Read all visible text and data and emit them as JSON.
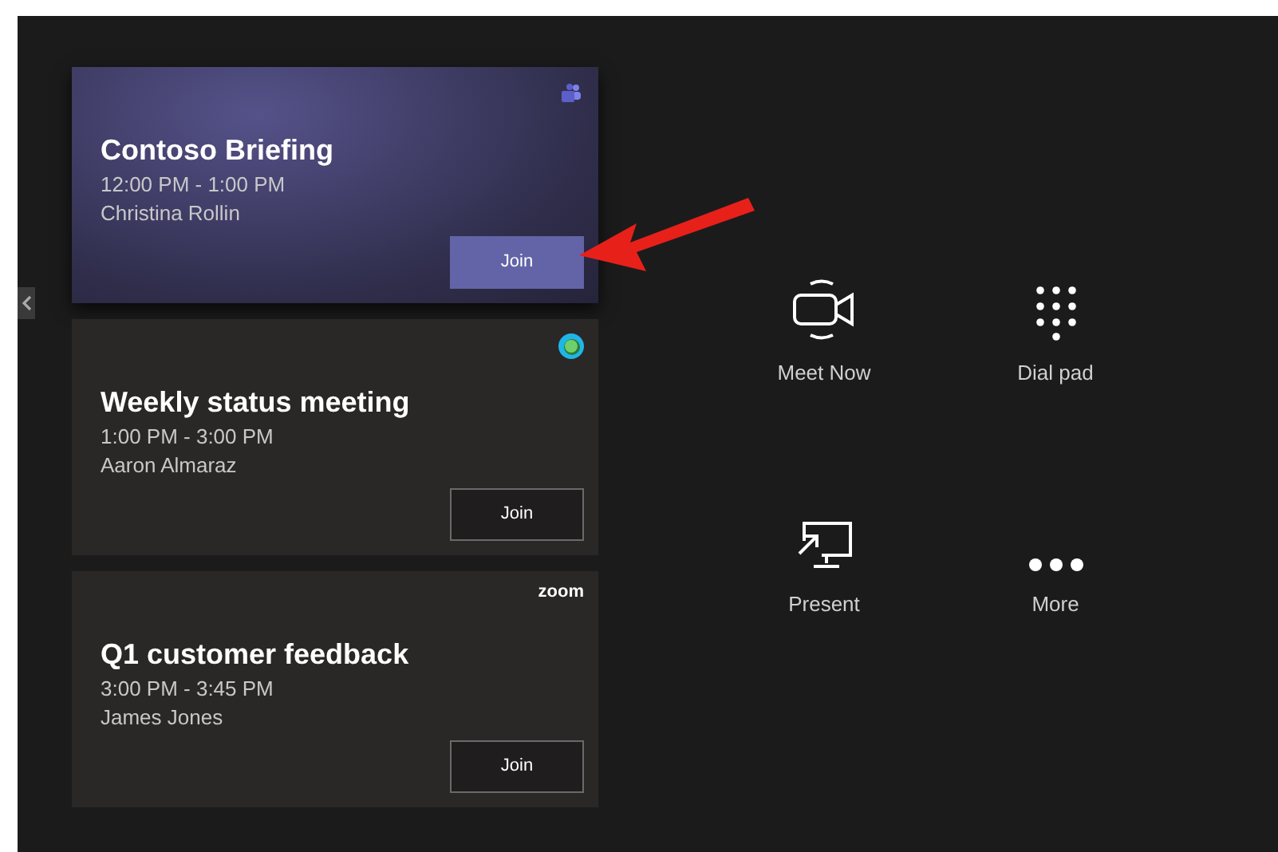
{
  "meetings": [
    {
      "title": "Contoso Briefing",
      "time": "12:00 PM - 1:00 PM",
      "organizer": "Christina Rollin",
      "join": "Join",
      "selected": true,
      "service": {
        "kind": "teams"
      }
    },
    {
      "title": "Weekly status meeting",
      "time": "1:00 PM - 3:00 PM",
      "organizer": "Aaron Almaraz",
      "join": "Join",
      "selected": false,
      "service": {
        "kind": "webex"
      }
    },
    {
      "title": "Q1 customer feedback",
      "time": "3:00 PM - 3:45 PM",
      "organizer": "James Jones",
      "join": "Join",
      "selected": false,
      "service": {
        "kind": "zoom",
        "text": "zoom"
      }
    }
  ],
  "actions": [
    {
      "kind": "meet",
      "label": "Meet Now"
    },
    {
      "kind": "dialpad",
      "label": "Dial pad"
    },
    {
      "kind": "present",
      "label": "Present"
    },
    {
      "kind": "more",
      "label": "More"
    }
  ]
}
